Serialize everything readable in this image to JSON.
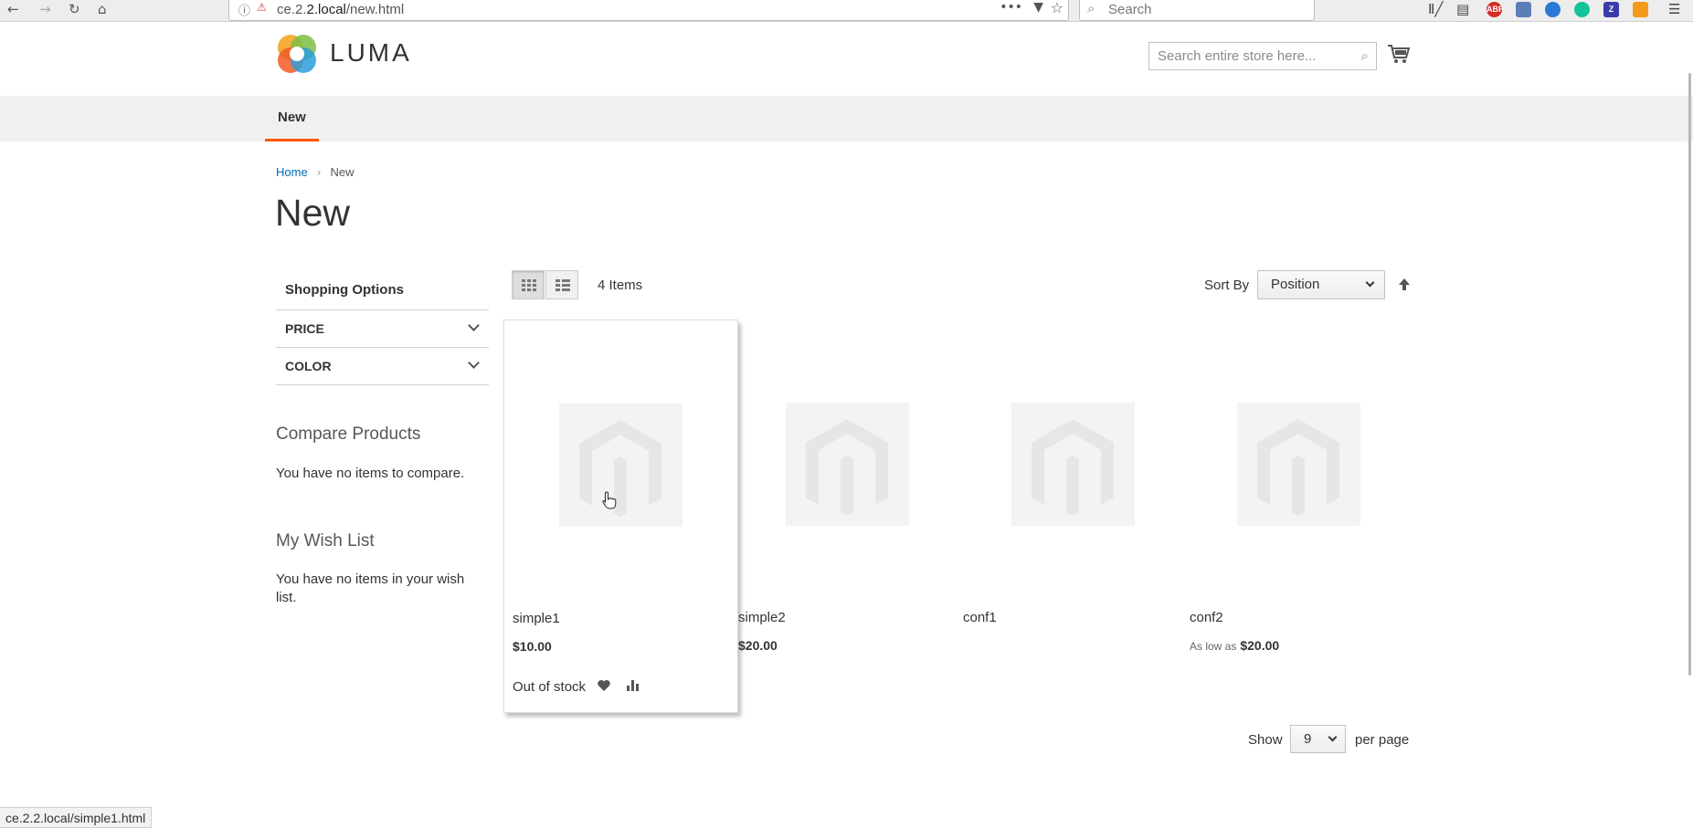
{
  "browser": {
    "url_prefix": "ce.2.",
    "url_host_mid": "2.local",
    "url_path": "/new.html",
    "search_placeholder": "Search",
    "status_url": "ce.2.2.local/simple1.html",
    "ext_abp": "ABP",
    "ext_z": "Z"
  },
  "store": {
    "logo_text": "LUMA",
    "search_placeholder": "Search entire store here..."
  },
  "nav": {
    "items": [
      "New"
    ]
  },
  "breadcrumb": {
    "home": "Home",
    "current": "New"
  },
  "page_title": "New",
  "sidebar": {
    "shopping_options": "Shopping Options",
    "filters": [
      "Price",
      "Color"
    ],
    "compare_title": "Compare Products",
    "compare_text": "You have no items to compare.",
    "wishlist_title": "My Wish List",
    "wishlist_text_1": "You have no items in your wish",
    "wishlist_text_2": "list."
  },
  "toolbar": {
    "items_count": "4 Items",
    "sort_label": "Sort By",
    "sort_value": "Position"
  },
  "products": [
    {
      "name": "simple1",
      "price": "$10.00",
      "price_prefix": "",
      "stock": "Out of stock"
    },
    {
      "name": "simple2",
      "price": "$20.00",
      "price_prefix": ""
    },
    {
      "name": "conf1",
      "price": "",
      "price_prefix": ""
    },
    {
      "name": "conf2",
      "price": "$20.00",
      "price_prefix": "As low as"
    }
  ],
  "limiter": {
    "show_label": "Show",
    "value": "9",
    "per_page_label": "per page"
  },
  "colors": {
    "accent": "#ff5501",
    "link": "#006bb4"
  }
}
